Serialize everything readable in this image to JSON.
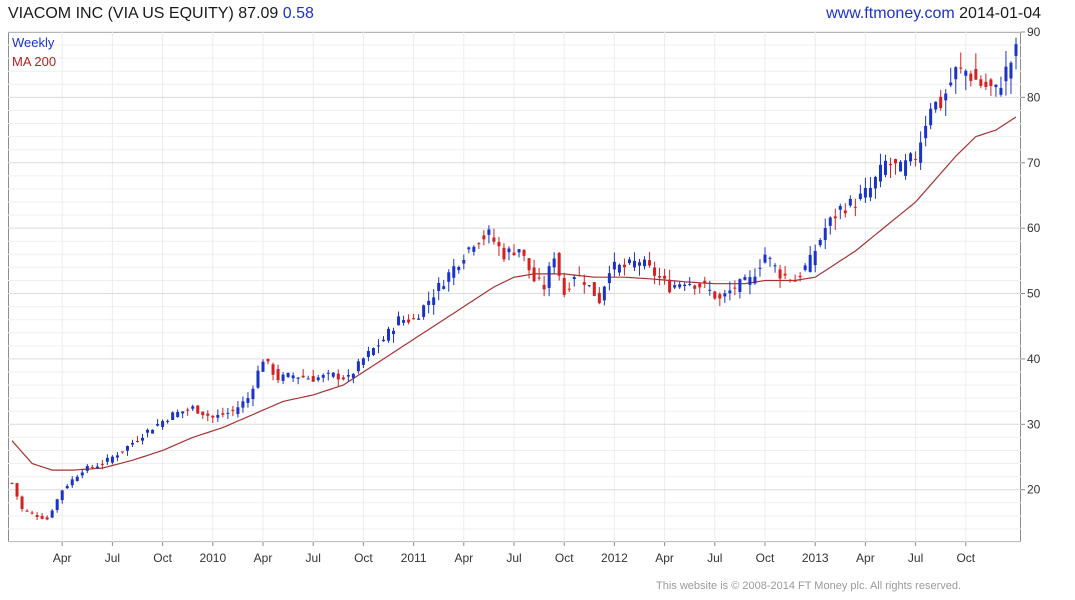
{
  "header": {
    "name": "VIACOM INC (VIA US EQUITY)",
    "price": "87.09",
    "change": "0.58",
    "site": "www.ftmoney.com",
    "date": "2014-01-04"
  },
  "legend": {
    "series1": "Weekly",
    "series2": "MA 200"
  },
  "footer": "This website is © 2008-2014 FT Money plc. All rights reserved.",
  "colors": {
    "up": "#1a33c8",
    "down": "#d42020",
    "ma": "#a83232",
    "grid": "#dcdcdc"
  },
  "chart_data": {
    "type": "candlestick",
    "title": "VIACOM INC (VIA US EQUITY)",
    "ylim": [
      12,
      90
    ],
    "yticks": [
      20,
      30,
      40,
      50,
      60,
      70,
      80,
      90
    ],
    "xlim": [
      0,
      200
    ],
    "xticks": [
      {
        "x": 10,
        "label": "Apr"
      },
      {
        "x": 20,
        "label": "Jul"
      },
      {
        "x": 30,
        "label": "Oct"
      },
      {
        "x": 40,
        "label": "2010"
      },
      {
        "x": 50,
        "label": "Apr"
      },
      {
        "x": 60,
        "label": "Jul"
      },
      {
        "x": 70,
        "label": "Oct"
      },
      {
        "x": 80,
        "label": "2011"
      },
      {
        "x": 90,
        "label": "Apr"
      },
      {
        "x": 100,
        "label": "Jul"
      },
      {
        "x": 110,
        "label": "Oct"
      },
      {
        "x": 120,
        "label": "2012"
      },
      {
        "x": 130,
        "label": "Apr"
      },
      {
        "x": 140,
        "label": "Jul"
      },
      {
        "x": 150,
        "label": "Oct"
      },
      {
        "x": 160,
        "label": "2013"
      },
      {
        "x": 170,
        "label": "Apr"
      },
      {
        "x": 180,
        "label": "Jul"
      },
      {
        "x": 190,
        "label": "Oct"
      }
    ],
    "grid": true,
    "weekly_anchors": [
      [
        0,
        21
      ],
      [
        2,
        17
      ],
      [
        5,
        16
      ],
      [
        7,
        15.5
      ],
      [
        10,
        20
      ],
      [
        14,
        23
      ],
      [
        18,
        24
      ],
      [
        22,
        26
      ],
      [
        27,
        29
      ],
      [
        32,
        31.5
      ],
      [
        36,
        32.5
      ],
      [
        40,
        31
      ],
      [
        44,
        32
      ],
      [
        47,
        34
      ],
      [
        50,
        40
      ],
      [
        53,
        37
      ],
      [
        56,
        37.5
      ],
      [
        60,
        37
      ],
      [
        64,
        37.5
      ],
      [
        67,
        37
      ],
      [
        70,
        40
      ],
      [
        74,
        43
      ],
      [
        77,
        46
      ],
      [
        80,
        46
      ],
      [
        84,
        50
      ],
      [
        88,
        54
      ],
      [
        92,
        58
      ],
      [
        95,
        59
      ],
      [
        98,
        56
      ],
      [
        101,
        57
      ],
      [
        104,
        52
      ],
      [
        106,
        51
      ],
      [
        108,
        56
      ],
      [
        110,
        50
      ],
      [
        112,
        53
      ],
      [
        114,
        52
      ],
      [
        117,
        49
      ],
      [
        119,
        54
      ],
      [
        122,
        54
      ],
      [
        125,
        55
      ],
      [
        128,
        53
      ],
      [
        131,
        51
      ],
      [
        134,
        52
      ],
      [
        138,
        51
      ],
      [
        141,
        49
      ],
      [
        144,
        51
      ],
      [
        147,
        52
      ],
      [
        150,
        56
      ],
      [
        153,
        53
      ],
      [
        156,
        52
      ],
      [
        159,
        55
      ],
      [
        162,
        60
      ],
      [
        165,
        63
      ],
      [
        168,
        64
      ],
      [
        171,
        66
      ],
      [
        174,
        70
      ],
      [
        177,
        69
      ],
      [
        180,
        71
      ],
      [
        183,
        79
      ],
      [
        185,
        79
      ],
      [
        188,
        84
      ],
      [
        190,
        84
      ],
      [
        193,
        82
      ],
      [
        196,
        81
      ],
      [
        198,
        84
      ],
      [
        200,
        87
      ]
    ],
    "ma_anchors": [
      [
        0,
        27.5
      ],
      [
        4,
        24
      ],
      [
        8,
        23
      ],
      [
        12,
        23
      ],
      [
        18,
        23.3
      ],
      [
        24,
        24.5
      ],
      [
        30,
        26
      ],
      [
        36,
        28
      ],
      [
        42,
        29.5
      ],
      [
        48,
        31.5
      ],
      [
        54,
        33.5
      ],
      [
        60,
        34.5
      ],
      [
        66,
        36
      ],
      [
        72,
        39
      ],
      [
        78,
        42
      ],
      [
        84,
        45
      ],
      [
        90,
        48
      ],
      [
        96,
        51
      ],
      [
        100,
        52.5
      ],
      [
        104,
        53
      ],
      [
        110,
        53
      ],
      [
        116,
        52.5
      ],
      [
        122,
        52.5
      ],
      [
        128,
        52.2
      ],
      [
        134,
        51.8
      ],
      [
        140,
        51.5
      ],
      [
        146,
        51.5
      ],
      [
        150,
        52
      ],
      [
        156,
        52
      ],
      [
        160,
        52.5
      ],
      [
        164,
        54.5
      ],
      [
        168,
        56.5
      ],
      [
        172,
        59
      ],
      [
        176,
        61.5
      ],
      [
        180,
        64
      ],
      [
        184,
        67.5
      ],
      [
        188,
        71
      ],
      [
        192,
        74
      ],
      [
        196,
        75
      ],
      [
        200,
        77
      ]
    ],
    "series": [
      {
        "name": "Weekly"
      },
      {
        "name": "MA 200"
      }
    ]
  }
}
